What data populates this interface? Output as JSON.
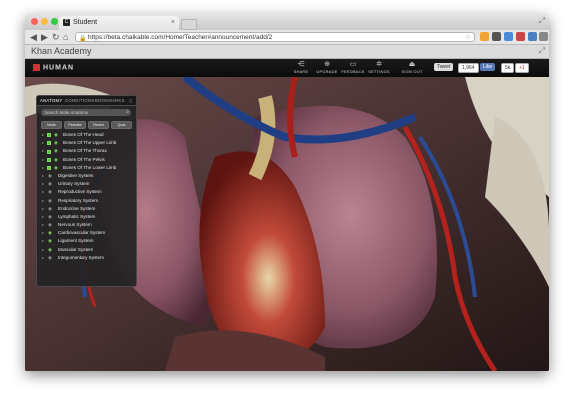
{
  "browser": {
    "tab_title": "Student",
    "tab_favicon_letter": "C",
    "tab_close_glyph": "×",
    "url": "https://beta.chalkable.com/Home/Teacher#announcement/add/2",
    "bookmarks_bar_title": "Khan Academy",
    "back_glyph": "◀",
    "forward_glyph": "▶",
    "reload_glyph": "↻",
    "home_glyph": "⌂",
    "lock_glyph": "🔒",
    "star_glyph": "☆",
    "traffic_colors": [
      "#fc605b",
      "#fdbc40",
      "#34c84a"
    ]
  },
  "app": {
    "brand": "HUMAN",
    "tools": [
      {
        "icon": "share-icon",
        "glyph": "⋲",
        "label": "SHARE"
      },
      {
        "icon": "upgrade-icon",
        "glyph": "⊕",
        "label": "UPGRADE"
      },
      {
        "icon": "feedback-icon",
        "glyph": "▭",
        "label": "FEEDBACK"
      },
      {
        "icon": "gear-icon",
        "glyph": "✲",
        "label": "SETTINGS"
      },
      {
        "icon": "signout-icon",
        "glyph": "⏏",
        "label": "SIGN OUT"
      }
    ],
    "tweet_label": "Tweet",
    "tweet_count": "1,964",
    "like_label": "Like",
    "like_count": "5k",
    "gplus_label": "+1",
    "accent_color": "#c33333"
  },
  "panel": {
    "tabs": [
      "ANATOMY",
      "CONDITIONS",
      "BOOKMARKS"
    ],
    "search_placeholder": "Search Male Anatomy",
    "buttons": [
      "Male",
      "Female",
      "Reset",
      "Quiz"
    ],
    "items": [
      {
        "label": "Bones Of The Head",
        "visible": true,
        "sub": true
      },
      {
        "label": "Bones Of The Upper Limb",
        "visible": true,
        "sub": true
      },
      {
        "label": "Bones Of The Thorax",
        "visible": true,
        "sub": true
      },
      {
        "label": "Bones Of The Pelvis",
        "visible": true,
        "sub": true
      },
      {
        "label": "Bones Of The Lower Limb",
        "visible": true,
        "sub": true
      },
      {
        "label": "Digestive System",
        "visible": false,
        "sub": false
      },
      {
        "label": "Urinary System",
        "visible": false,
        "sub": false
      },
      {
        "label": "Reproductive System",
        "visible": false,
        "sub": false
      },
      {
        "label": "Respiratory System",
        "visible": false,
        "sub": false
      },
      {
        "label": "Endocrine System",
        "visible": false,
        "sub": false
      },
      {
        "label": "Lymphatic System",
        "visible": false,
        "sub": false
      },
      {
        "label": "Nervous System",
        "visible": false,
        "sub": false
      },
      {
        "label": "Cardiovascular System",
        "visible": true,
        "sub": false
      },
      {
        "label": "Ligament System",
        "visible": true,
        "sub": false
      },
      {
        "label": "Muscular System",
        "visible": true,
        "sub": false
      },
      {
        "label": "Integumentary System",
        "visible": false,
        "sub": false
      }
    ]
  }
}
